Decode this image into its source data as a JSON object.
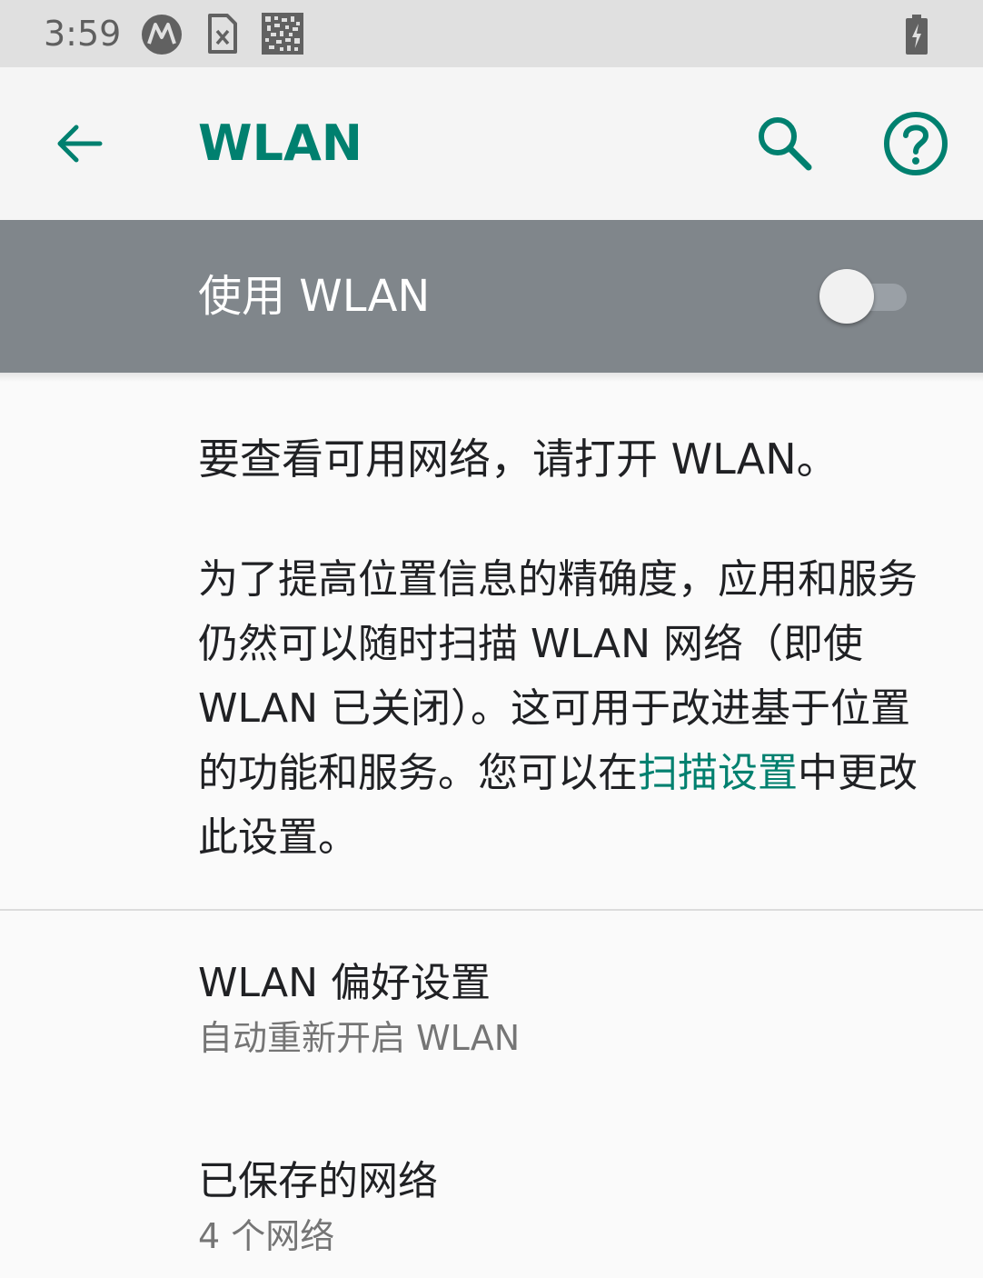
{
  "status_bar": {
    "time": "3:59",
    "icons": [
      "motorola-logo-icon",
      "sim-card-icon",
      "qr-code-icon",
      "battery-charging-icon"
    ]
  },
  "toolbar": {
    "title": "WLAN",
    "back_icon": "arrow-back-icon",
    "search_icon": "search-icon",
    "help_icon": "help-icon"
  },
  "master_switch": {
    "label": "使用 WLAN",
    "checked": false
  },
  "content": {
    "empty_message": "要查看可用网络，请打开 WLAN。",
    "scan_text_before": "为了提高位置信息的精确度，应用和服务仍然可以随时扫描 WLAN 网络（即使 WLAN 已关闭）。这可用于改进基于位置的功能和服务。您可以在",
    "scan_link": "扫描设置",
    "scan_text_after": "中更改此设置。"
  },
  "preferences": [
    {
      "title": "WLAN 偏好设置",
      "summary": "自动重新开启 WLAN"
    },
    {
      "title": "已保存的网络",
      "summary": "4 个网络"
    }
  ],
  "colors": {
    "accent": "#00806f",
    "switch_bar": "#80868b",
    "status_bar": "#e0e0e0"
  }
}
